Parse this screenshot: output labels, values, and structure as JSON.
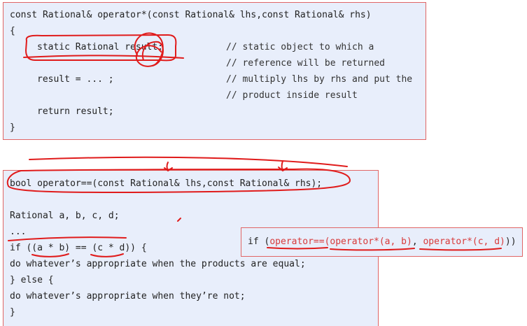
{
  "snippet1": {
    "line1": "const Rational& operator*(const Rational& lhs,const Rational& rhs)",
    "line2": "{",
    "line3": "static Rational result;",
    "line4": "result = ... ;",
    "line5": "return result;",
    "line6": "}",
    "comment1": "// static object to which a",
    "comment2": "// reference will be returned",
    "comment3": "// multiply lhs by rhs and put the",
    "comment4": "// product inside result"
  },
  "snippet2": {
    "line1": "bool operator==(const Rational& lhs,const Rational& rhs);",
    "line2": "Rational a, b, c, d;",
    "line3": "...",
    "line4": "if ((a * b) == (c * d)) {",
    "line5": "do whatever’s appropriate when the products are equal;",
    "line6": "} else {",
    "line7": "do whatever’s appropriate when they’re not;",
    "line8": "}"
  },
  "snippet3": {
    "prefix": "if (",
    "op_eq": "operator==(",
    "op_mul1": "operator*(a, b)",
    "sep": ", ",
    "op_mul2": "operator*(c, d)",
    "suffix": "))"
  },
  "colors": {
    "annotation_red": "#e01b1b",
    "box_fill": "#e8eefb",
    "box_border": "#e06565"
  }
}
